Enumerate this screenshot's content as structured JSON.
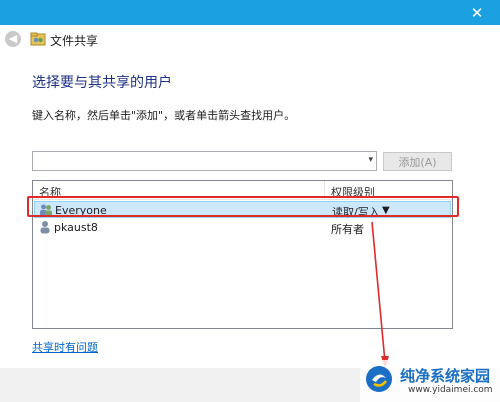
{
  "titlebar": {
    "close_glyph": "✕"
  },
  "header": {
    "back_glyph": "◀",
    "window_title": "文件共享",
    "icon": "share-folder-icon"
  },
  "content": {
    "heading": "选择要与其共享的用户",
    "instruction": "键入名称，然后单击\"添加\"，或者单击箭头查找用户。",
    "combo": {
      "value": "",
      "arrow_glyph": "▾"
    },
    "add_button": "添加(A)",
    "list": {
      "columns": {
        "name": "名称",
        "permission": "权限级别"
      },
      "rows": [
        {
          "name": "Everyone",
          "permission": "读取/写入",
          "arrow": "▼",
          "icon": "group-icon",
          "selected": true
        },
        {
          "name": "pkaust8",
          "permission": "所有者",
          "icon": "user-icon",
          "selected": false
        }
      ]
    },
    "help_link": "共享时有问题"
  },
  "watermark": {
    "title": "纯净系统家园",
    "url": "www.yidaimei.com"
  },
  "colors": {
    "titlebar": "#1ba1e2",
    "highlight": "#e02b2b",
    "heading": "#1e3287",
    "link": "#0066cc"
  }
}
